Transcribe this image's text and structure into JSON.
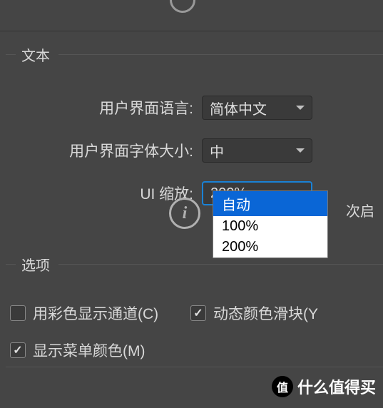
{
  "sections": {
    "text": {
      "title": "文本",
      "fields": {
        "uiLanguage": {
          "label": "用户界面语言:",
          "value": "简体中文"
        },
        "uiFontSize": {
          "label": "用户界面字体大小:",
          "value": "中"
        },
        "uiScale": {
          "label": "UI 缩放:",
          "value": "200%",
          "options": [
            "自动",
            "100%",
            "200%"
          ],
          "selectedIndex": 0
        }
      },
      "hint": "次启"
    },
    "options": {
      "title": "选项",
      "checkboxes": {
        "colorChannels": {
          "label": "用彩色显示通道(C)",
          "checked": false
        },
        "dynamicSliders": {
          "label": "动态颜色滑块(Y",
          "checked": true
        },
        "menuColors": {
          "label": "显示菜单颜色(M)",
          "checked": true
        }
      }
    }
  },
  "watermark": {
    "badge": "值",
    "text": "什么值得买"
  }
}
